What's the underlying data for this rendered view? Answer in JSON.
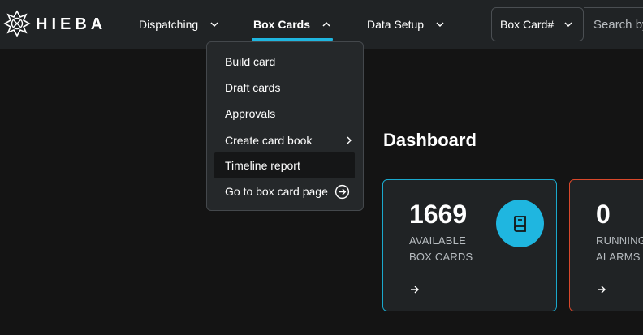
{
  "header": {
    "brand": "HIEBA",
    "nav": [
      {
        "label": "Dispatching"
      },
      {
        "label": "Box Cards"
      },
      {
        "label": "Data Setup"
      }
    ],
    "search_type": "Box Card#",
    "search_placeholder": "Search by Box Card#"
  },
  "box_cards_menu": {
    "items": [
      {
        "label": "Build card"
      },
      {
        "label": "Draft cards"
      },
      {
        "label": "Approvals"
      },
      {
        "label": "Create card book"
      },
      {
        "label": "Timeline report"
      },
      {
        "label": "Go to box card page"
      }
    ]
  },
  "dashboard": {
    "title": "Dashboard",
    "cards": [
      {
        "value": "1669",
        "label_line1": "AVAILABLE",
        "label_line2": "BOX CARDS"
      },
      {
        "value": "0",
        "label_line1": "RUNNING",
        "label_line2": "ALARMS"
      }
    ]
  },
  "colors": {
    "accent": "#1fb6e0",
    "alarm": "#d9482b",
    "background": "#141414",
    "surface": "#202325"
  },
  "icons": {
    "logo": "maltese-cross-logo-icon",
    "card_available": "book-icon",
    "go_to": "arrow-circle-right-icon"
  }
}
